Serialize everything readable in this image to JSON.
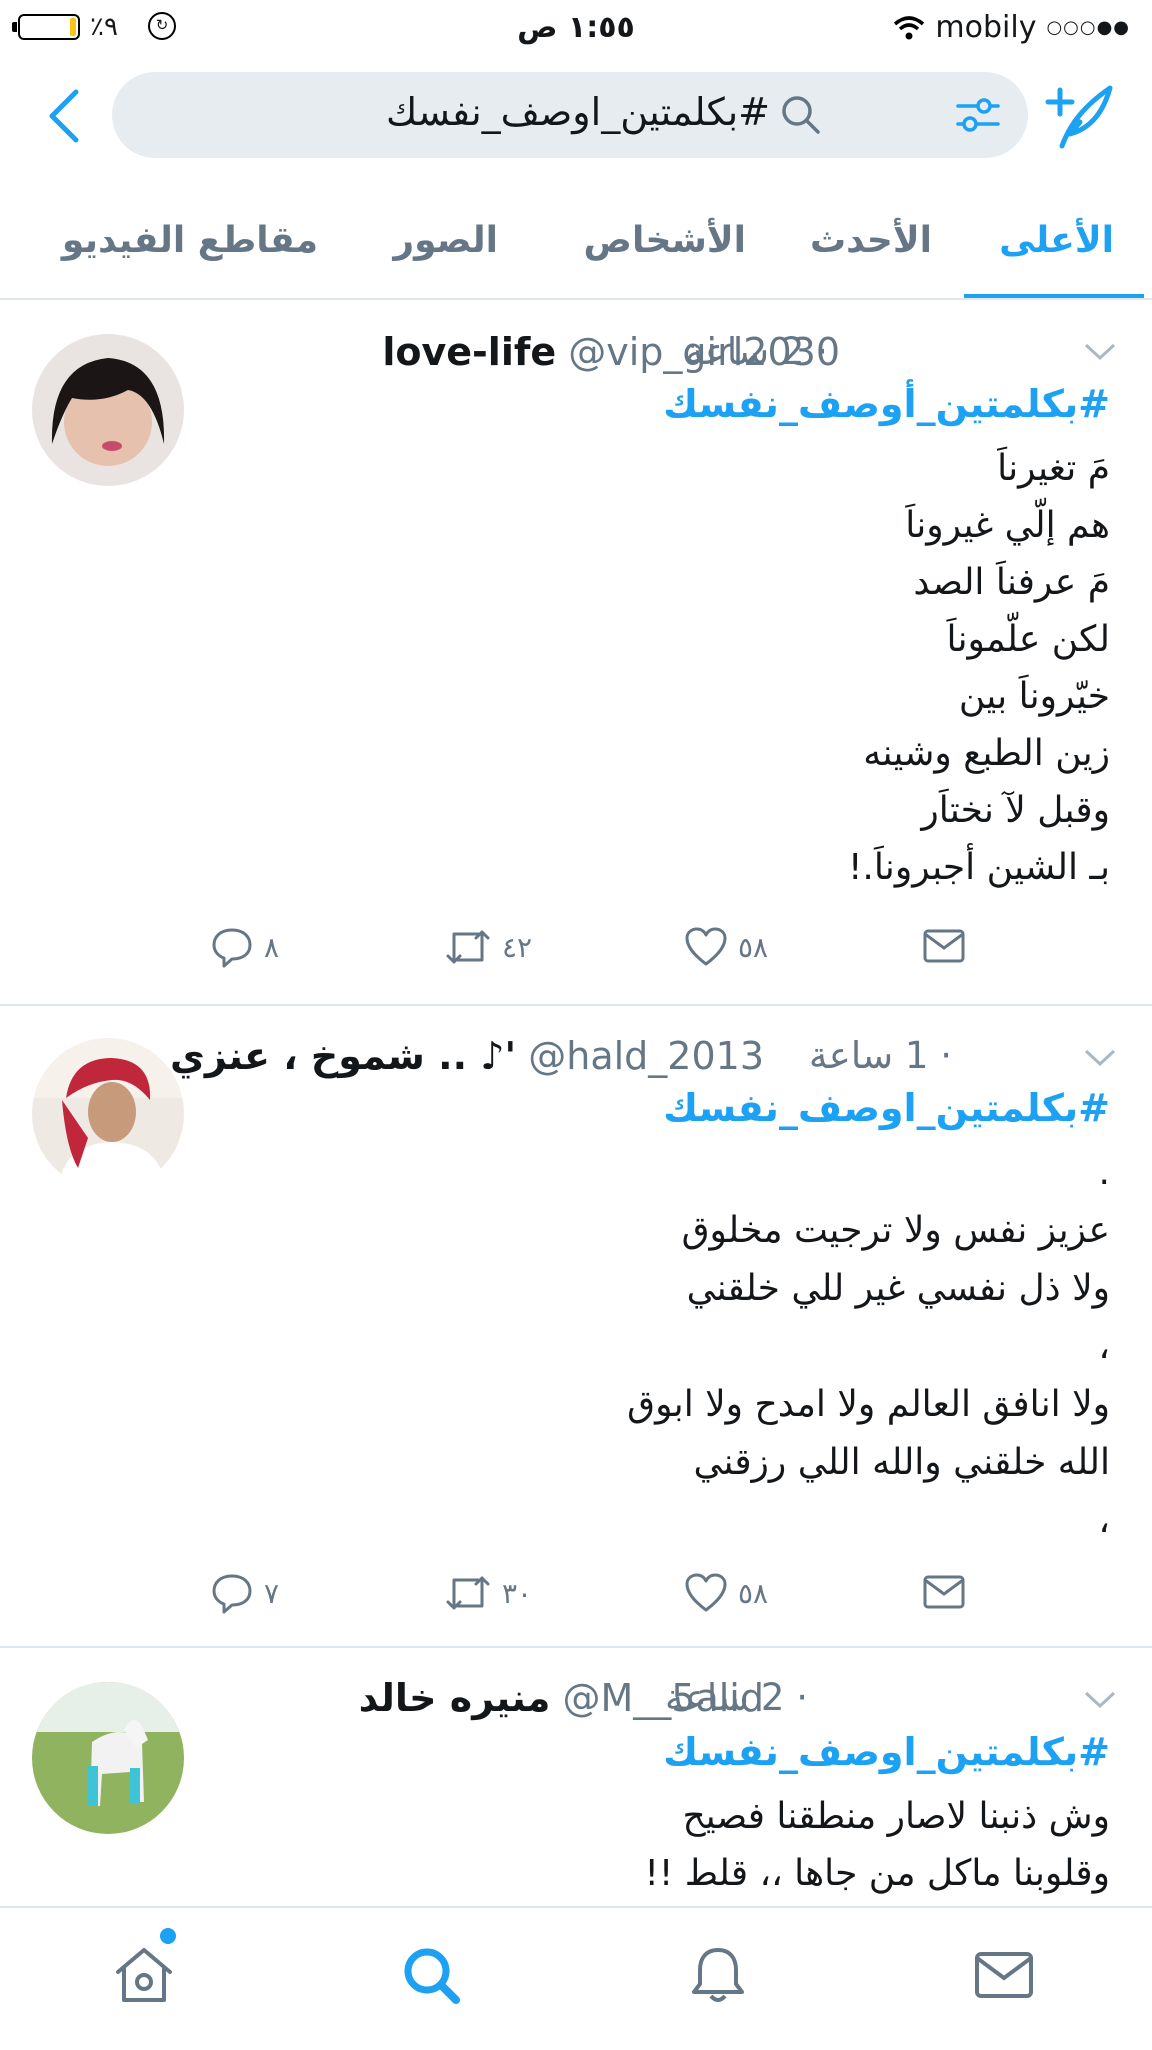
{
  "status_bar": {
    "battery_pct": "٪٩",
    "time": "١:٥٥ ص",
    "carrier": "mobily",
    "signal": "○○○●●"
  },
  "search": {
    "query": "#بكلمتين_اوصف_نفسك"
  },
  "tabs": [
    {
      "label": "الأعلى",
      "active": true
    },
    {
      "label": "الأحدث",
      "active": false
    },
    {
      "label": "الأشخاص",
      "active": false
    },
    {
      "label": "الصور",
      "active": false
    },
    {
      "label": "مقاطع الفيديو",
      "active": false
    }
  ],
  "tweets": [
    {
      "name": "love-life",
      "handle": "@vip_girl2030",
      "time": "· 2 ساعة",
      "hashtag": "#بكلمتين_أوصف_نفسك",
      "lines": [
        "مَ تغيرناَ",
        "هم إلّي غيروناَ",
        "مَ عرفناَ الصد",
        "لكن علّموناَ",
        "خيّروناَ بين",
        "زين الطبع وشينه",
        "وقبل لآ نختاَر",
        "بـ الشين أجبروناَ.!"
      ],
      "reply_count": "٨",
      "retweet_count": "٤٢",
      "like_count": "٥٨"
    },
    {
      "name": "شموخ ، عنزي .. ♪'",
      "handle": "@hald_2013",
      "time": "· 1 ساعة",
      "hashtag": "#بكلمتين_اوصف_نفسك",
      "lines": [
        ".",
        "عزيز نفس ولا ترجيت مخلوق",
        "ولا ذل نفسي غير للي خلقني",
        "،",
        "ولا انافق العالم ولا امدح ولا ابوق",
        "الله خلقني والله اللي رزقني",
        "،"
      ],
      "reply_count": "٧",
      "retweet_count": "٣٠",
      "like_count": "٥٨"
    },
    {
      "name": "منيره خالد",
      "handle": "@M__5alid",
      "time": "· 2 ساعة",
      "hashtag": "#بكلمتين_اوصف_نفسك",
      "lines": [
        "وش ذنبنا لاصار منطقنا فصيح",
        "وقلوبنا ماكل من جاها ،، قلط !!"
      ]
    }
  ],
  "icons": {
    "back": "chevron-left-icon",
    "filter": "sliders-icon",
    "search": "search-icon",
    "compose": "compose-tweet-icon",
    "reply": "reply-icon",
    "retweet": "retweet-icon",
    "like": "heart-icon",
    "dm": "envelope-icon",
    "home": "home-icon",
    "explore": "search-icon",
    "notifications": "bell-icon",
    "messages": "envelope-icon"
  },
  "colors": {
    "accent": "#1da1f2",
    "muted": "#657786",
    "search_bg": "#e6ecf0"
  }
}
